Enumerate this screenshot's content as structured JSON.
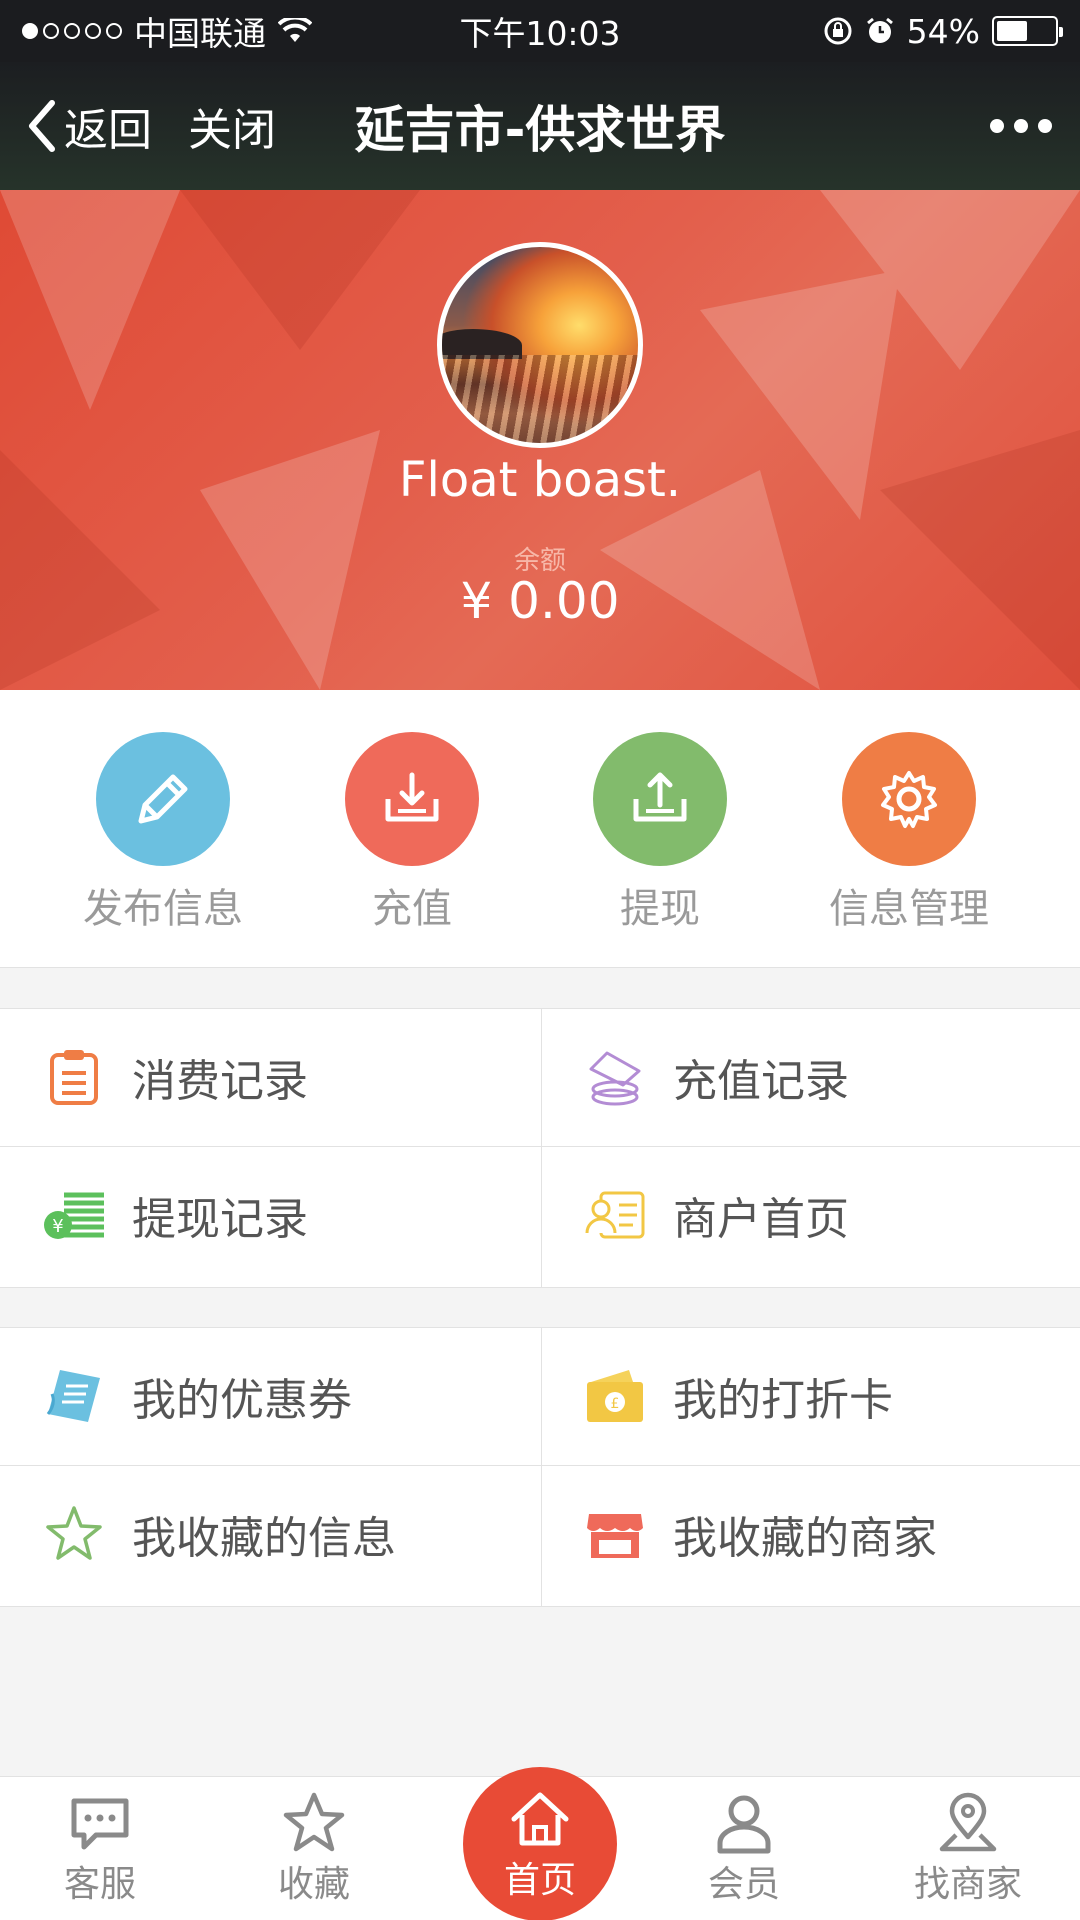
{
  "status_bar": {
    "carrier": "中国联通",
    "time": "下午10:03",
    "battery": "54%",
    "battery_level": 0.54
  },
  "nav": {
    "back_label": "返回",
    "close_label": "关闭",
    "title": "延吉市-供求世界"
  },
  "profile": {
    "username": "Float boast.",
    "balance_label": "余额",
    "balance_value": "¥ 0.00"
  },
  "actions": [
    {
      "label": "发布信息",
      "icon": "pencil-icon",
      "color": "#6bc0e0"
    },
    {
      "label": "充值",
      "icon": "download-icon",
      "color": "#ef6a5a"
    },
    {
      "label": "提现",
      "icon": "upload-icon",
      "color": "#82bb6c"
    },
    {
      "label": "信息管理",
      "icon": "gear-icon",
      "color": "#ef7d45"
    }
  ],
  "menu1": [
    {
      "label": "消费记录",
      "icon": "clipboard-icon"
    },
    {
      "label": "充值记录",
      "icon": "coins-icon"
    },
    {
      "label": "提现记录",
      "icon": "cash-icon"
    },
    {
      "label": "商户首页",
      "icon": "id-card-icon"
    }
  ],
  "menu2": [
    {
      "label": "我的优惠券",
      "icon": "coupon-icon"
    },
    {
      "label": "我的打折卡",
      "icon": "wallet-icon"
    },
    {
      "label": "我收藏的信息",
      "icon": "star-icon"
    },
    {
      "label": "我收藏的商家",
      "icon": "store-icon"
    }
  ],
  "tabs": [
    {
      "label": "客服",
      "icon": "chat-icon"
    },
    {
      "label": "收藏",
      "icon": "star-icon"
    },
    {
      "label": "首页",
      "icon": "home-icon"
    },
    {
      "label": "会员",
      "icon": "user-icon"
    },
    {
      "label": "找商家",
      "icon": "location-icon"
    }
  ]
}
